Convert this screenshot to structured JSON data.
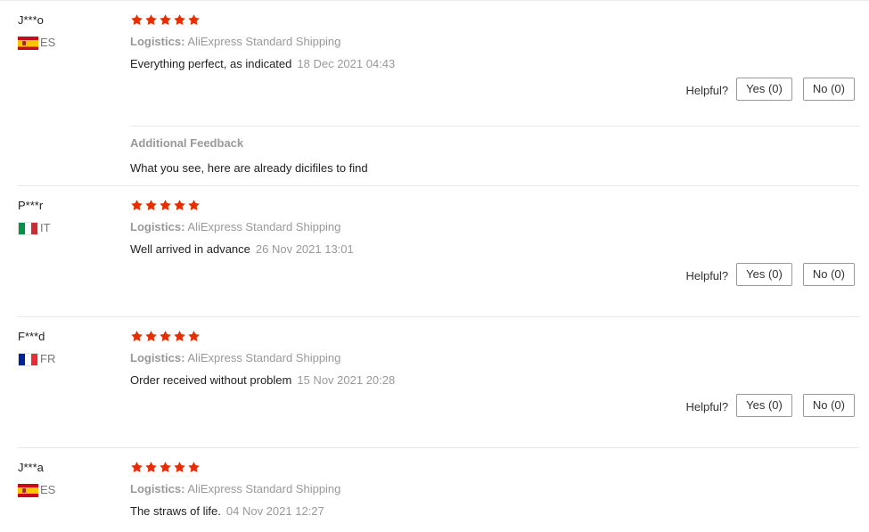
{
  "colors": {
    "star": "#e62e04",
    "muted": "#999999",
    "border": "#e8e8e8"
  },
  "helpful_label": "Helpful?",
  "reviews": [
    {
      "user": "J***o",
      "country": "ES",
      "flag": "spain-flag-icon",
      "rating": 5,
      "logistics_label": "Logistics:",
      "logistics_value": "AliExpress Standard Shipping",
      "text": "Everything perfect, as indicated",
      "date": "18 Dec 2021 04:43",
      "yes": "Yes (0)",
      "no": "No (0)",
      "additional_title": "Additional Feedback",
      "additional_text": "What you see, here are already dicifiles to find"
    },
    {
      "user": "P***r",
      "country": "IT",
      "flag": "italy-flag-icon",
      "rating": 5,
      "logistics_label": "Logistics:",
      "logistics_value": "AliExpress Standard Shipping",
      "text": "Well arrived in advance",
      "date": "26 Nov 2021 13:01",
      "yes": "Yes (0)",
      "no": "No (0)"
    },
    {
      "user": "F***d",
      "country": "FR",
      "flag": "france-flag-icon",
      "rating": 5,
      "logistics_label": "Logistics:",
      "logistics_value": "AliExpress Standard Shipping",
      "text": "Order received without problem",
      "date": "15 Nov 2021 20:28",
      "yes": "Yes (0)",
      "no": "No (0)"
    },
    {
      "user": "J***a",
      "country": "ES",
      "flag": "spain-flag-icon",
      "rating": 5,
      "logistics_label": "Logistics:",
      "logistics_value": "AliExpress Standard Shipping",
      "text": "The straws of life.",
      "date": "04 Nov 2021 12:27"
    }
  ]
}
